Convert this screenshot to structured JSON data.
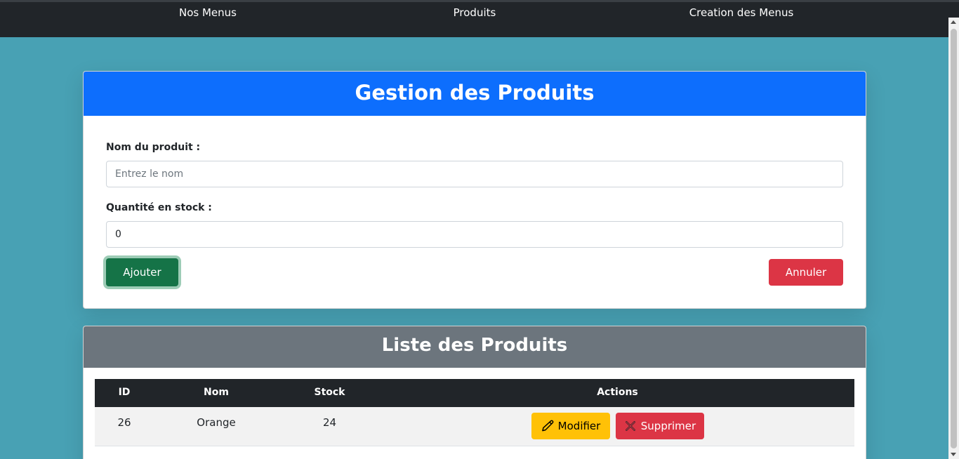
{
  "nav": {
    "items": [
      {
        "label": "Nos Menus"
      },
      {
        "label": "Produits"
      },
      {
        "label": "Creation des Menus"
      }
    ]
  },
  "form": {
    "title": "Gestion des Produits",
    "name_label": "Nom du produit :",
    "name_placeholder": "Entrez le nom",
    "name_value": "",
    "stock_label": "Quantité en stock :",
    "stock_value": "0",
    "add_label": "Ajouter",
    "cancel_label": "Annuler"
  },
  "list": {
    "title": "Liste des Produits",
    "columns": [
      "ID",
      "Nom",
      "Stock",
      "Actions"
    ],
    "rows": [
      {
        "id": "26",
        "nom": "Orange",
        "stock": "24",
        "edit_label": "Modifier",
        "delete_label": "Supprimer"
      }
    ]
  },
  "icons": {
    "edit": "pencil-icon",
    "delete": "x-icon"
  },
  "colors": {
    "primary": "#0d6efd",
    "secondary": "#6c757d",
    "success": "#157347",
    "danger": "#dc3545",
    "warning": "#ffc107",
    "dark": "#212529",
    "background": "#48a1b4"
  }
}
